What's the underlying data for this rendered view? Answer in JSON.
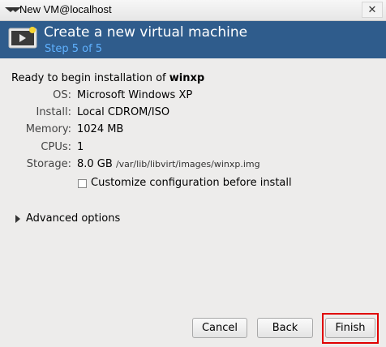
{
  "window": {
    "title": "New VM@localhost",
    "close_glyph": "✕"
  },
  "header": {
    "title": "Create a new virtual machine",
    "subtitle": "Step 5 of 5",
    "icon": "vm-screen-icon",
    "background": "#2f5c8c",
    "subtitle_color": "#5fb1ff"
  },
  "summary": {
    "ready_prefix": "Ready to begin installation of ",
    "vm_name": "winxp",
    "rows": [
      {
        "label": "OS:",
        "value": "Microsoft Windows XP"
      },
      {
        "label": "Install:",
        "value": "Local CDROM/ISO"
      },
      {
        "label": "Memory:",
        "value": "1024 MB"
      },
      {
        "label": "CPUs:",
        "value": "1"
      },
      {
        "label": "Storage:",
        "value": "8.0 GB",
        "extra": "/var/lib/libvirt/images/winxp.img"
      }
    ]
  },
  "customize": {
    "label": "Customize configuration before install",
    "checked": false
  },
  "advanced": {
    "label": "Advanced options",
    "expanded": false
  },
  "buttons": {
    "cancel": "Cancel",
    "back": "Back",
    "finish": "Finish"
  },
  "highlight_color": "#e00000"
}
